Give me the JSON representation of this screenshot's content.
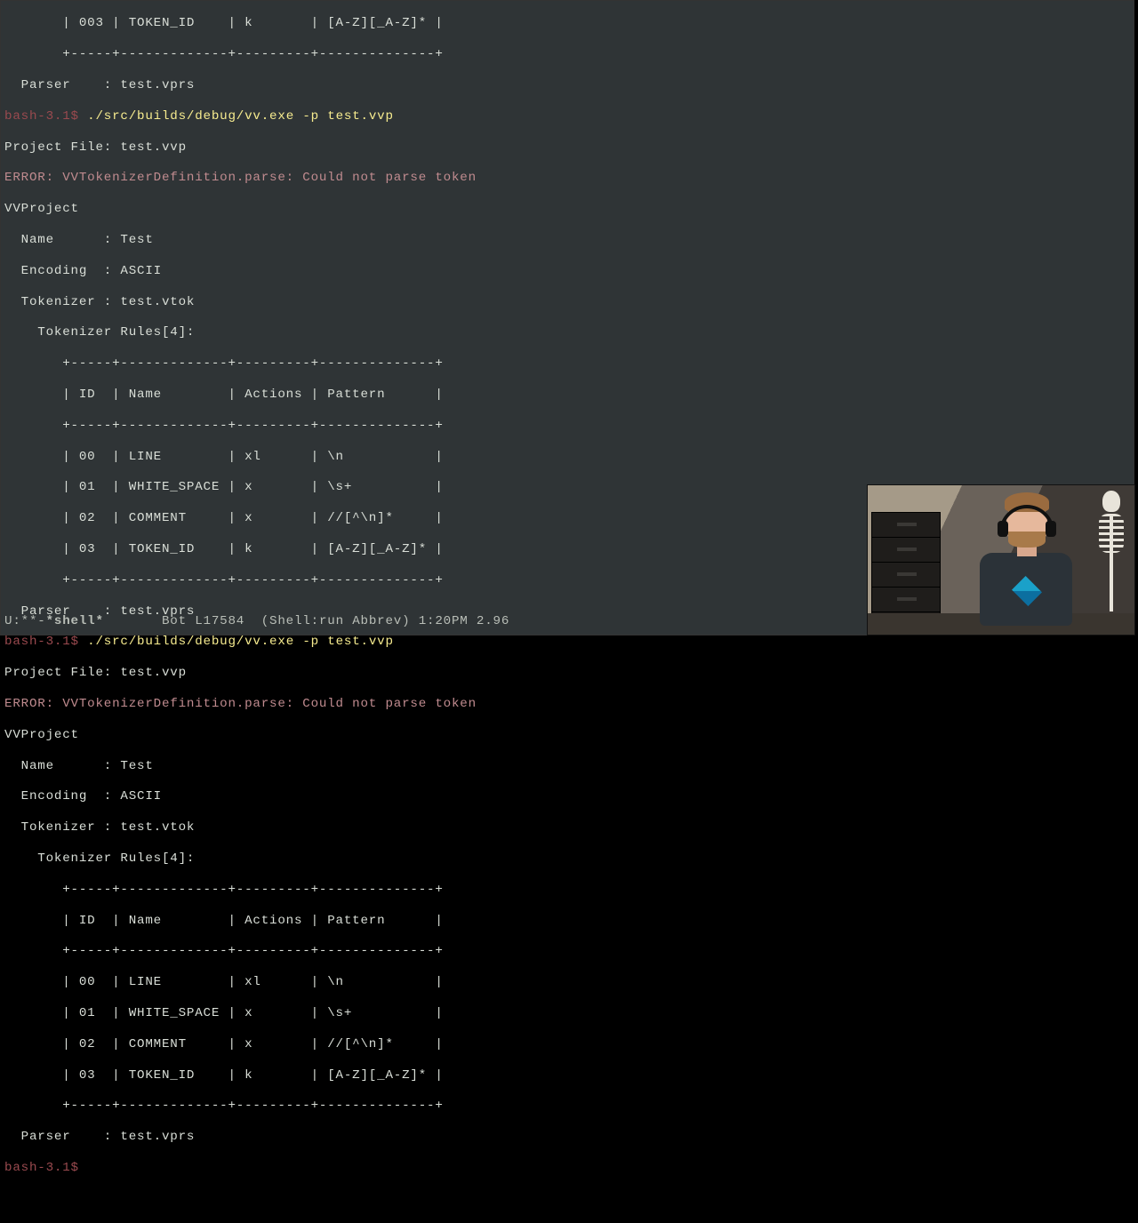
{
  "partial": {
    "row": "       | 003 | TOKEN_ID    | k       | [A-Z][_A-Z]* |",
    "sep": "       +-----+-------------+---------+--------------+",
    "parser": "  Parser    : test.vprs"
  },
  "prompt_prefix": "bash-3.1",
  "prompt_sigil": "$ ",
  "command": "./src/builds/debug/vv.exe -p test.vvp",
  "run": {
    "projfile": "Project File: test.vvp",
    "error": "ERROR: VVTokenizerDefinition.parse: Could not parse token",
    "vvproj": "VVProject",
    "name": "  Name      : Test",
    "encoding": "  Encoding  : ASCII",
    "tokenizer": "  Tokenizer : test.vtok",
    "rules": "    Tokenizer Rules[4]:",
    "tsep": "       +-----+-------------+---------+--------------+",
    "thead": "       | ID  | Name        | Actions | Pattern      |",
    "r0": "       | 00  | LINE        | xl      | \\n           |",
    "r1": "       | 01  | WHITE_SPACE | x       | \\s+          |",
    "r2": "       | 02  | COMMENT     | x       | //[^\\n]*     |",
    "r3": "       | 03  | TOKEN_ID    | k       | [A-Z][_A-Z]* |",
    "parser": "  Parser    : test.vprs"
  },
  "empty_prompt": "bash-3.1",
  "status": {
    "left": "U:**-",
    "buffer": "*shell*",
    "mid": "       Bot L17584  (Shell:run Abbrev) 1:20PM 2.96"
  }
}
